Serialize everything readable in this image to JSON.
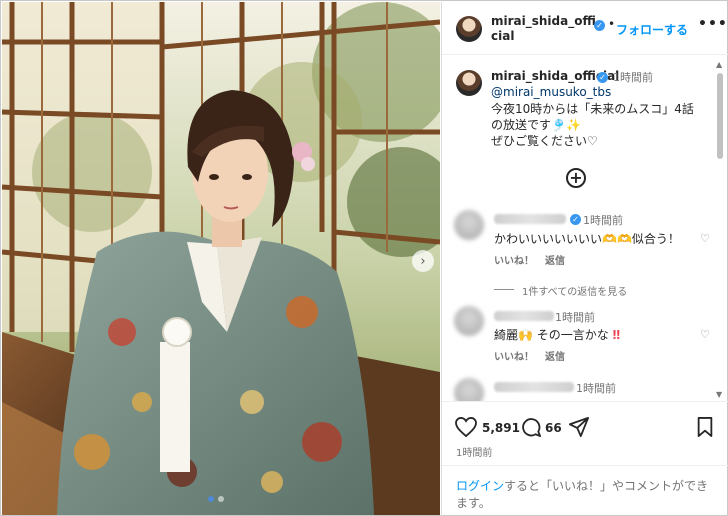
{
  "header": {
    "username": "mirai_shida_official",
    "separator": "•",
    "follow_label": "フォローする",
    "more_label": "•••"
  },
  "photo": {
    "next_label": "›",
    "slide_count": 2,
    "active_slide": 1
  },
  "caption": {
    "username": "mirai_shida_official",
    "time": "1時間前",
    "mention": "@mirai_musuko_tbs",
    "lines": [
      "今夜10時からは「未来のムスコ」4話",
      "の放送です🎐✨",
      "ぜひご覧ください♡"
    ],
    "load_more_label": "+"
  },
  "comments": [
    {
      "time": "1時間前",
      "text": "かわいいいいいいい🫶🫶似合う！",
      "like_label": "いいね！",
      "reply_label": "返信"
    },
    {
      "time": "1時間前",
      "text_main": "綺麗🙌 その一言かな",
      "text_mark": "‼",
      "like_label": "いいね！",
      "reply_label": "返信"
    },
    {
      "time": "1時間前"
    }
  ],
  "view_replies_label": "1件すべての返信を見る",
  "actions": {
    "like_count": "5,891",
    "comment_count": "66",
    "post_time": "1時間前"
  },
  "login_prompt": {
    "link": "ログイン",
    "text": "すると「いいね！」やコメントができます。"
  },
  "colors": {
    "accent": "#0095f6",
    "verified": "#3897f0",
    "text": "#262626",
    "muted": "#737373"
  }
}
